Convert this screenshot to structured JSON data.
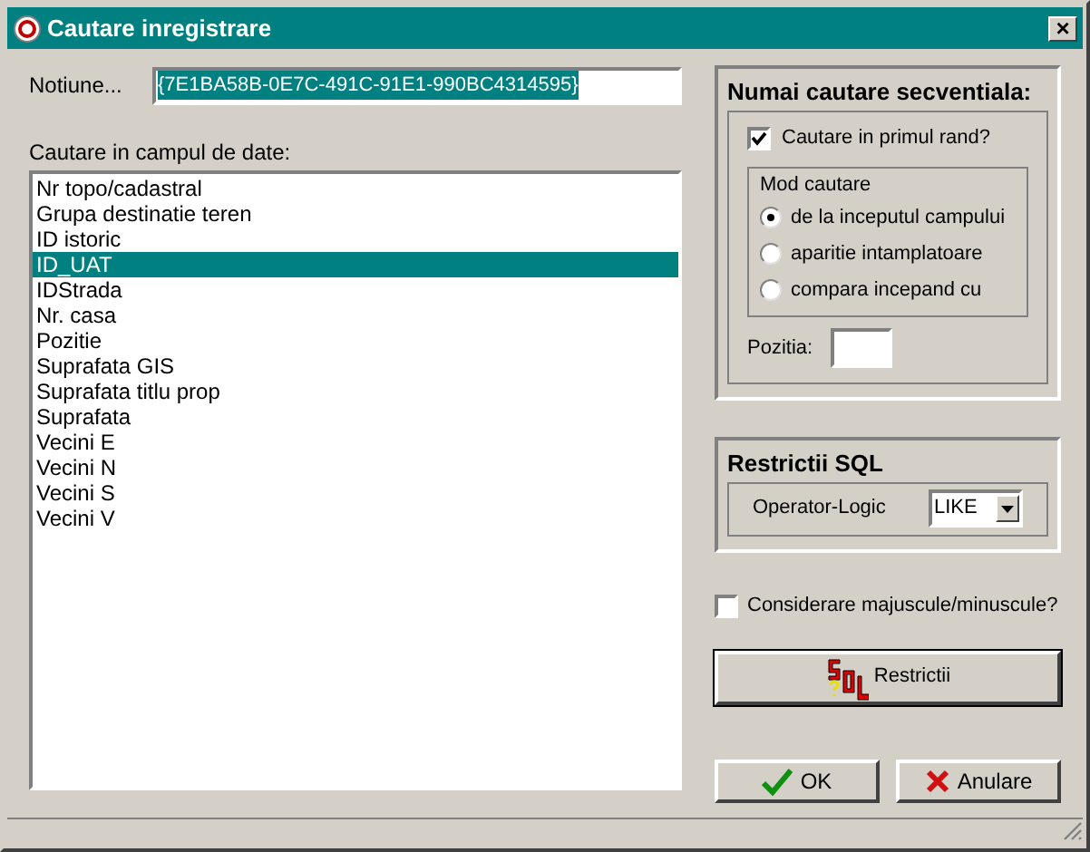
{
  "window": {
    "title": "Cautare inregistrare",
    "close": "×"
  },
  "notion": {
    "label": "Notiune...",
    "value": "{7E1BA58B-0E7C-491C-91E1-990BC4314595}"
  },
  "fields": {
    "label": "Cautare in campul de date:",
    "items": [
      {
        "label": "Nr topo/cadastral",
        "selected": false
      },
      {
        "label": "Grupa destinatie teren",
        "selected": false
      },
      {
        "label": "ID istoric",
        "selected": false
      },
      {
        "label": "ID_UAT",
        "selected": true
      },
      {
        "label": "IDStrada",
        "selected": false
      },
      {
        "label": "Nr. casa",
        "selected": false
      },
      {
        "label": "Pozitie",
        "selected": false
      },
      {
        "label": "Suprafata GIS",
        "selected": false
      },
      {
        "label": "Suprafata titlu prop",
        "selected": false
      },
      {
        "label": "Suprafata",
        "selected": false
      },
      {
        "label": "Vecini E",
        "selected": false
      },
      {
        "label": "Vecini N",
        "selected": false
      },
      {
        "label": "Vecini S",
        "selected": false
      },
      {
        "label": "Vecini V",
        "selected": false
      }
    ]
  },
  "sequential": {
    "title": "Numai cautare secventiala:",
    "first_row": {
      "label": "Cautare in primul rand?",
      "checked": true
    },
    "mode": {
      "title": "Mod cautare",
      "options": [
        {
          "label": "de la inceputul campului",
          "selected": true
        },
        {
          "label": "aparitie intamplatoare",
          "selected": false
        },
        {
          "label": "compara incepand cu",
          "selected": false
        }
      ]
    },
    "position": {
      "label": "Pozitia:"
    }
  },
  "sql": {
    "title": "Restrictii SQL",
    "operator_label": "Operator-Logic",
    "operator": "LIKE"
  },
  "case_sensitive": {
    "label": "Considerare majuscule/minuscule?",
    "checked": false
  },
  "buttons": {
    "restrict": "Restrictii",
    "ok": "OK",
    "cancel": "Anulare"
  }
}
